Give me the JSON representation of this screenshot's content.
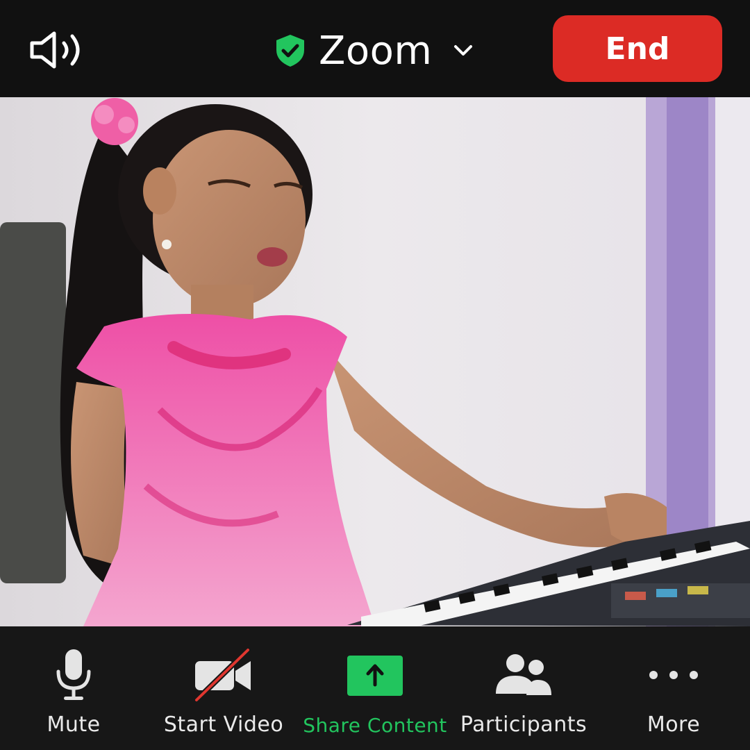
{
  "header": {
    "title": "Zoom",
    "end_label": "End",
    "speaker_icon": "speaker-icon",
    "security_icon": "shield-check-icon",
    "dropdown_icon": "chevron-down-icon"
  },
  "video": {
    "content": "participant video feed"
  },
  "toolbar": {
    "items": [
      {
        "label": "Mute",
        "icon": "microphone-icon"
      },
      {
        "label": "Start Video",
        "icon": "video-off-icon"
      },
      {
        "label": "Share Content",
        "icon": "share-upload-icon"
      },
      {
        "label": "Participants",
        "icon": "participants-icon"
      },
      {
        "label": "More",
        "icon": "more-dots-icon"
      }
    ]
  },
  "colors": {
    "end_button": "#dc2b25",
    "share_green": "#22c55e",
    "background": "#111111"
  }
}
